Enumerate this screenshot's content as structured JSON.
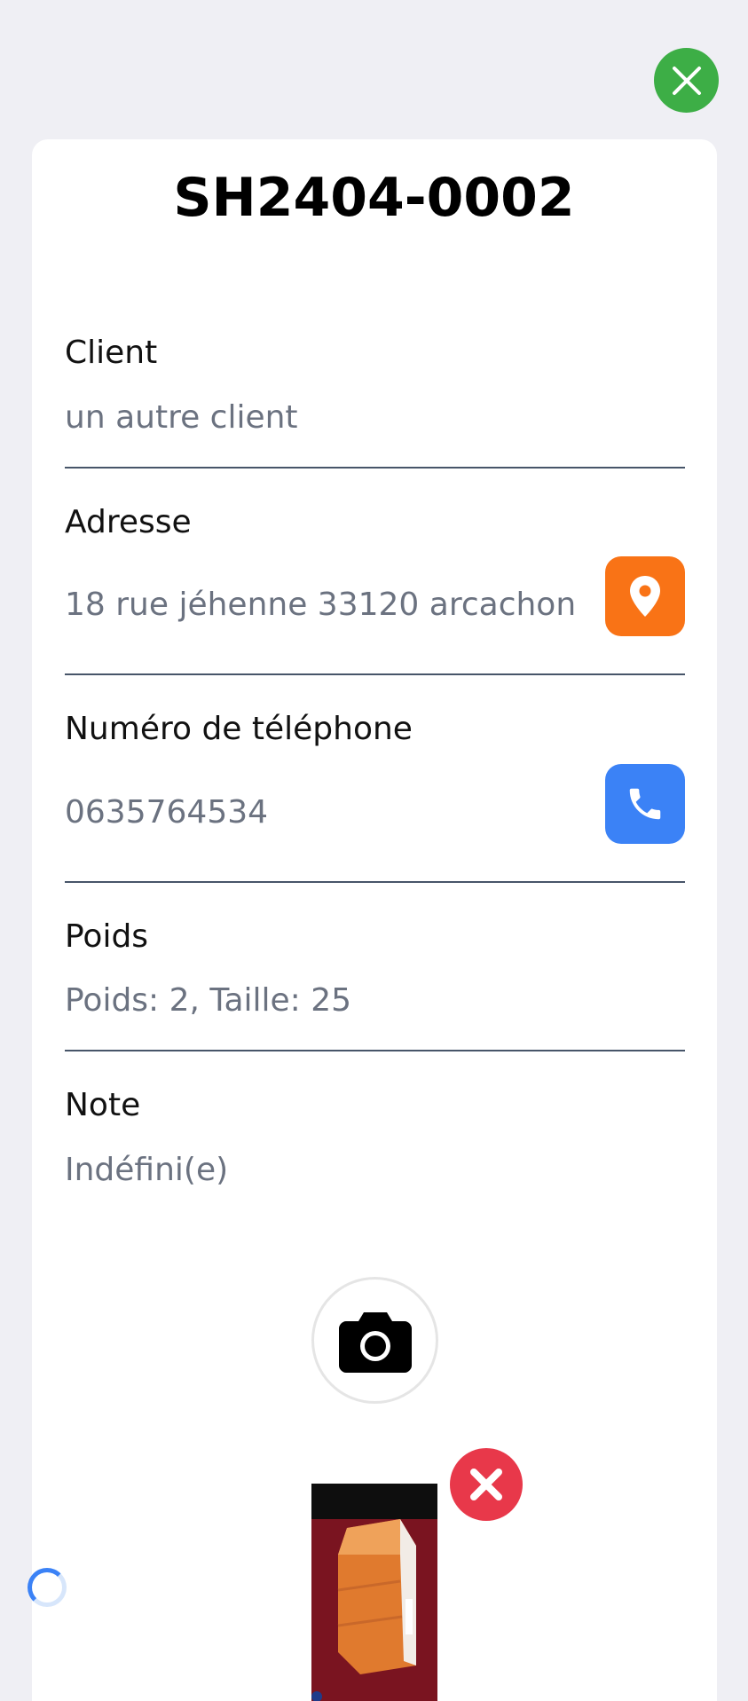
{
  "shipment": {
    "reference": "SH2404-0002"
  },
  "fields": {
    "client": {
      "label": "Client",
      "value": "un autre client"
    },
    "address": {
      "label": "Adresse",
      "value": "18 rue jéhenne 33120 arcachon"
    },
    "phone": {
      "label": "Numéro de téléphone",
      "value": "0635764534"
    },
    "weight": {
      "label": "Poids",
      "value": "Poids: 2, Taille: 25"
    },
    "note": {
      "label": "Note",
      "value": "Indéfini(e)"
    }
  },
  "icons": {
    "close": "close-icon",
    "map_pin": "map-pin-icon",
    "phone": "phone-icon",
    "camera": "camera-icon",
    "remove": "remove-icon"
  },
  "colors": {
    "close_button": "#3dae46",
    "map_button": "#f97316",
    "phone_button": "#3b82f6",
    "remove_button": "#e8384a",
    "spinner": "#3b82f6"
  }
}
